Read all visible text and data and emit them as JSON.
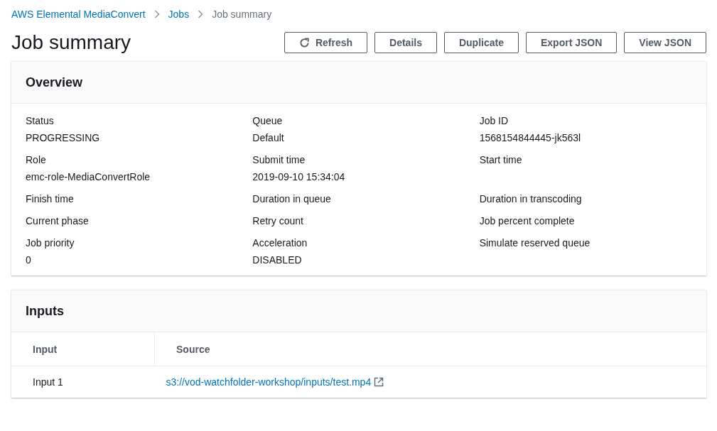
{
  "breadcrumb": [
    {
      "label": "AWS Elemental MediaConvert",
      "current": false
    },
    {
      "label": "Jobs",
      "current": false
    },
    {
      "label": "Job summary",
      "current": true
    }
  ],
  "page_title": "Job summary",
  "actions": [
    {
      "label": "Refresh",
      "kind": "icon-button"
    },
    {
      "label": "Details",
      "kind": "button"
    },
    {
      "label": "Duplicate",
      "kind": "button"
    },
    {
      "label": "Export JSON",
      "kind": "button"
    },
    {
      "label": "View JSON",
      "kind": "button"
    }
  ],
  "overview": {
    "title": "Overview",
    "fields": [
      {
        "label": "Status",
        "value": "PROGRESSING"
      },
      {
        "label": "Queue",
        "value": "Default"
      },
      {
        "label": "Job ID",
        "value": "1568154844445-jk563l"
      },
      {
        "label": "Role",
        "value": "emc-role-MediaConvertRole"
      },
      {
        "label": "Submit time",
        "value": "2019-09-10 15:34:04"
      },
      {
        "label": "Start time"
      },
      {
        "label": "Finish time"
      },
      {
        "label": "Duration in queue"
      },
      {
        "label": "Duration in transcoding"
      },
      {
        "label": "Current phase"
      },
      {
        "label": "Retry count"
      },
      {
        "label": "Job percent complete"
      },
      {
        "label": "Job priority",
        "value": "0"
      },
      {
        "label": "Acceleration",
        "value": "DISABLED"
      },
      {
        "label": "Simulate reserved queue"
      }
    ]
  },
  "inputs": {
    "title": "Inputs",
    "columns": [
      "Input",
      "Source"
    ],
    "rows": [
      {
        "input": "Input 1",
        "source": "s3://vod-watchfolder-workshop/inputs/test.mp4"
      }
    ]
  }
}
